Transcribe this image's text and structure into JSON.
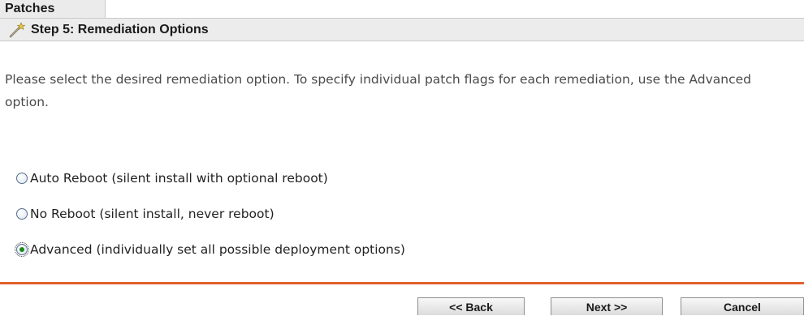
{
  "panel": {
    "tab_title": "Patches",
    "step_title": "Step 5: Remediation Options",
    "step_icon": "wand-icon"
  },
  "description": "Please select the desired remediation option. To specify individual patch flags for each remediation, use the Advanced option.",
  "options": [
    {
      "label": "Auto Reboot (silent install with optional reboot)",
      "selected": false
    },
    {
      "label": "No Reboot (silent install, never reboot)",
      "selected": false
    },
    {
      "label": "Advanced (individually set all possible deployment options)",
      "selected": true
    }
  ],
  "buttons": {
    "back": "<< Back",
    "next": "Next >>",
    "cancel": "Cancel"
  },
  "colors": {
    "accent_divider": "#e0612a",
    "header_bg": "#ececec",
    "radio_checked": "#1a8a1a"
  }
}
